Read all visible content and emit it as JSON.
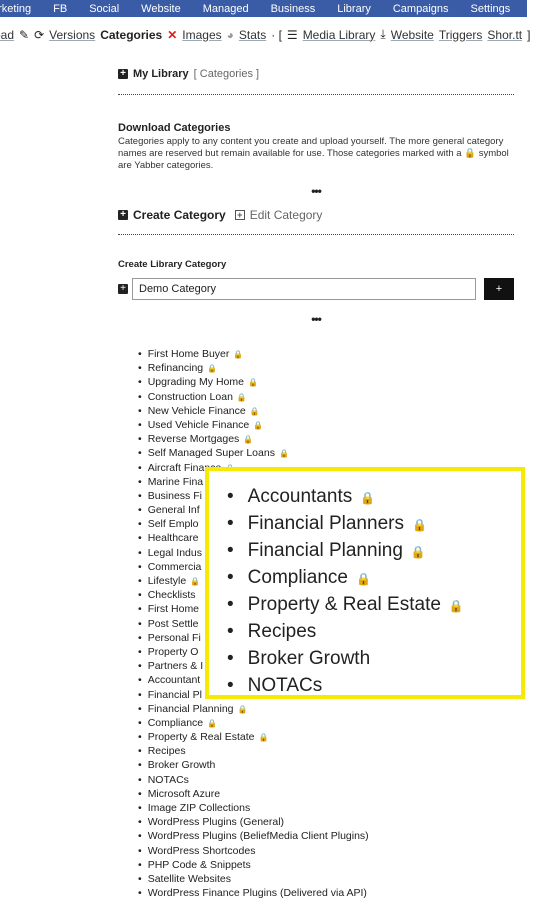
{
  "nav": [
    "arketing",
    "FB",
    "Social",
    "Website",
    "Managed",
    "Business",
    "Library",
    "Campaigns",
    "Settings"
  ],
  "subnav": {
    "load": "oad",
    "versions": "Versions",
    "categories": "Categories",
    "images": "Images",
    "stats": "Stats",
    "sep": "· [",
    "media": "Media Library",
    "website": "Website",
    "triggers": "Triggers",
    "shortt": "Shor.tt",
    "close": "]"
  },
  "my_library": {
    "title": "My Library",
    "bracket": "[ Categories ]"
  },
  "download": {
    "title": "Download Categories",
    "text": "Categories apply to any content you create and upload yourself. The more general category names are reserved but remain available for use. Those categories marked with a 🔒 symbol are Yabber categories."
  },
  "ellipsis": "•••",
  "create_tab": "Create Category",
  "edit_tab": "Edit Category",
  "form": {
    "label": "Create Library Category",
    "value": "Demo Category",
    "button": "+"
  },
  "categories": [
    {
      "name": "First Home Buyer",
      "locked": true
    },
    {
      "name": "Refinancing",
      "locked": true
    },
    {
      "name": "Upgrading My Home",
      "locked": true
    },
    {
      "name": "Construction Loan",
      "locked": true
    },
    {
      "name": "New Vehicle Finance",
      "locked": true
    },
    {
      "name": "Used Vehicle Finance",
      "locked": true
    },
    {
      "name": "Reverse Mortgages",
      "locked": true
    },
    {
      "name": "Self Managed Super Loans",
      "locked": true
    },
    {
      "name": "Aircraft Finance",
      "locked": true
    },
    {
      "name": "Marine Fina",
      "locked": false
    },
    {
      "name": "Business Fi",
      "locked": false
    },
    {
      "name": "General Inf",
      "locked": false
    },
    {
      "name": "Self Emplo",
      "locked": false
    },
    {
      "name": "Healthcare",
      "locked": false
    },
    {
      "name": "Legal Indus",
      "locked": false
    },
    {
      "name": "Commercia",
      "locked": false
    },
    {
      "name": "Lifestyle",
      "locked": true
    },
    {
      "name": "Checklists",
      "locked": false
    },
    {
      "name": "First Home",
      "locked": false
    },
    {
      "name": "Post Settle",
      "locked": false
    },
    {
      "name": "Personal Fi",
      "locked": false
    },
    {
      "name": "Property O",
      "locked": false
    },
    {
      "name": "Partners & I",
      "locked": false
    },
    {
      "name": "Accountant",
      "locked": false
    },
    {
      "name": "Financial Pl",
      "locked": false
    },
    {
      "name": "Financial Planning",
      "locked": true
    },
    {
      "name": "Compliance",
      "locked": true
    },
    {
      "name": "Property & Real Estate",
      "locked": true
    },
    {
      "name": "Recipes",
      "locked": false
    },
    {
      "name": "Broker Growth",
      "locked": false
    },
    {
      "name": "NOTACs",
      "locked": false
    },
    {
      "name": "Microsoft Azure",
      "locked": false
    },
    {
      "name": "Image ZIP Collections",
      "locked": false
    },
    {
      "name": "WordPress Plugins (General)",
      "locked": false
    },
    {
      "name": "WordPress Plugins (BeliefMedia Client Plugins)",
      "locked": false
    },
    {
      "name": "WordPress Shortcodes",
      "locked": false
    },
    {
      "name": "PHP Code & Snippets",
      "locked": false
    },
    {
      "name": "Satellite Websites",
      "locked": false
    },
    {
      "name": "WordPress Finance Plugins (Delivered via API)",
      "locked": false
    }
  ],
  "zoom_overlay": [
    {
      "name": "Accountants",
      "locked": true
    },
    {
      "name": "Financial Planners",
      "locked": true
    },
    {
      "name": "Financial Planning",
      "locked": true
    },
    {
      "name": "Compliance",
      "locked": true
    },
    {
      "name": "Property & Real Estate",
      "locked": true
    },
    {
      "name": "Recipes",
      "locked": false
    },
    {
      "name": "Broker Growth",
      "locked": false
    },
    {
      "name": "NOTACs",
      "locked": false
    }
  ],
  "colors": {
    "nav": "#3a5ba5",
    "highlight": "#f5ea00",
    "delete": "#e02020"
  }
}
